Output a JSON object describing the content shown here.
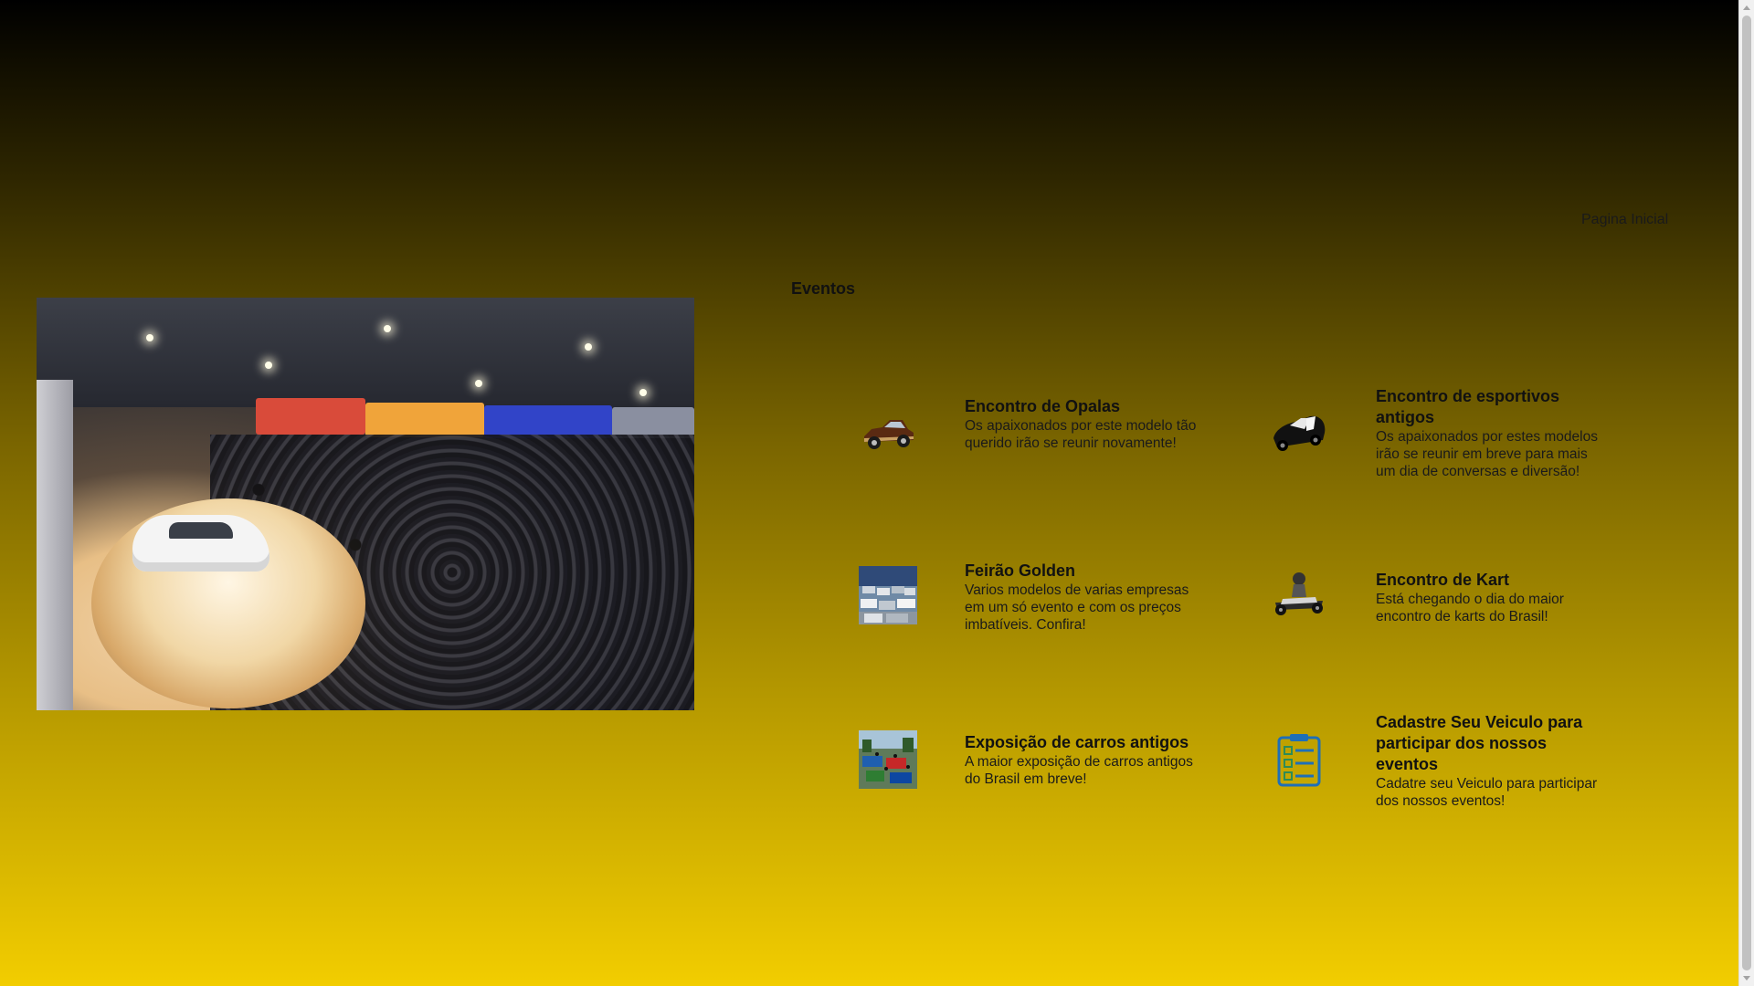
{
  "nav": {
    "home_label": "Pagina Inicial"
  },
  "events": {
    "section_title": "Eventos",
    "items": [
      {
        "title": "Encontro de Opalas",
        "description": "Os apaixonados por este modelo tão querido irão se reunir novamente!",
        "icon": "classic-car-icon"
      },
      {
        "title": "Encontro de esportivos antigos",
        "description": "Os apaixonados por estes modelos irão se reunir em breve para mais um dia de conversas e diversão!",
        "icon": "black-sports-car-icon"
      },
      {
        "title": "Feirão Golden",
        "description": "Varios modelos de varias empresas em um só evento e com os preços imbatíveis. Confira!",
        "icon": "car-lot-photo-icon"
      },
      {
        "title": "Encontro de Kart",
        "description": "Está chegando o dia do maior encontro de karts do Brasil!",
        "icon": "kart-icon"
      },
      {
        "title": "Exposição de carros antigos",
        "description": "A maior exposição de carros antigos do Brasil em breve!",
        "icon": "car-exhibition-photo-icon"
      },
      {
        "title": "Cadastre Seu Veiculo para participar dos nossos eventos",
        "description": "Cadatre seu Veiculo para participar dos nossos eventos!",
        "icon": "clipboard-checklist-icon"
      }
    ]
  },
  "colors": {
    "gradient_top": "#000000",
    "gradient_bottom": "#f2cd00"
  }
}
